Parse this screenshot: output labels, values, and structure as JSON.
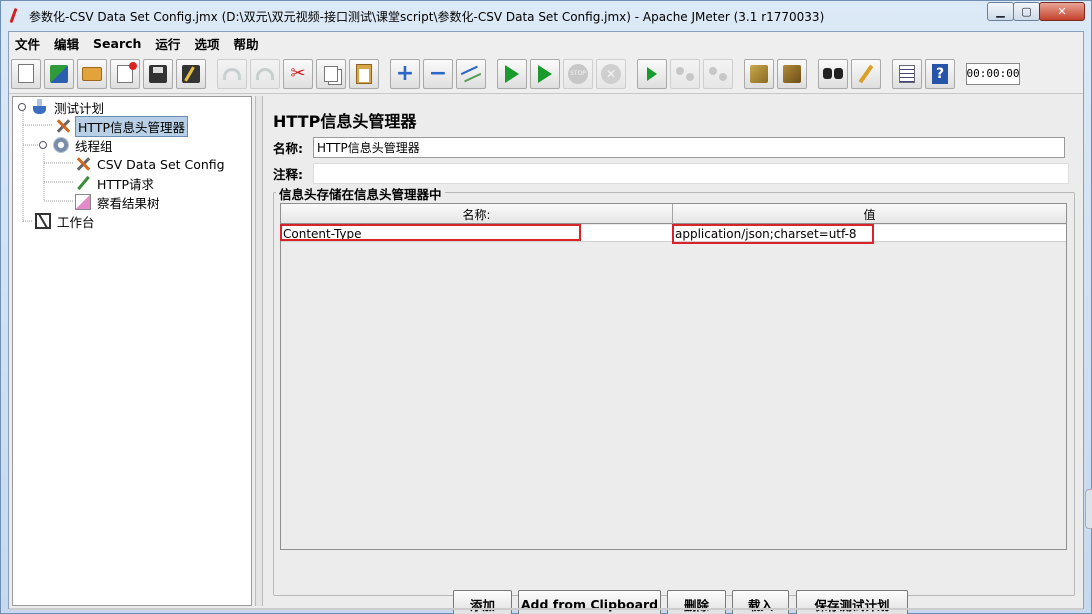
{
  "window": {
    "title": "参数化-CSV Data Set Config.jmx (D:\\双元\\双元视频-接口测试\\课堂script\\参数化-CSV Data Set Config.jmx) - Apache JMeter (3.1 r1770033)",
    "minimize_symbol": "▁",
    "maximize_symbol": "▢",
    "close_symbol": "✕"
  },
  "menu": {
    "items": [
      "文件",
      "编辑",
      "Search",
      "运行",
      "选项",
      "帮助"
    ]
  },
  "toolbar": {
    "timer": "00:00:00",
    "buttons": [
      {
        "name": "new-icon"
      },
      {
        "name": "templates-icon"
      },
      {
        "name": "open-icon"
      },
      {
        "name": "close-icon"
      },
      {
        "name": "save-icon"
      },
      {
        "name": "save-as-icon"
      },
      {
        "name": "undo-icon"
      },
      {
        "name": "redo-icon"
      },
      {
        "name": "cut-icon"
      },
      {
        "name": "copy-icon"
      },
      {
        "name": "paste-icon"
      },
      {
        "name": "expand-icon"
      },
      {
        "name": "collapse-icon"
      },
      {
        "name": "toggle-icon"
      },
      {
        "name": "start-icon"
      },
      {
        "name": "start-no-pause-icon"
      },
      {
        "name": "stop-icon"
      },
      {
        "name": "shutdown-icon"
      },
      {
        "name": "remote-start-icon"
      },
      {
        "name": "remote-stop-icon"
      },
      {
        "name": "remote-shutdown-icon"
      },
      {
        "name": "clear-icon"
      },
      {
        "name": "clear-all-icon"
      },
      {
        "name": "search-icon"
      },
      {
        "name": "reset-search-icon"
      },
      {
        "name": "function-helper-icon"
      },
      {
        "name": "help-icon"
      }
    ],
    "cut_glyph": "✂",
    "plus_glyph": "+",
    "minus_glyph": "−",
    "stop_glyph": "STOP",
    "shutdown_glyph": "✕",
    "help_glyph": "?"
  },
  "tree": {
    "nodes": [
      {
        "label": "测试计划"
      },
      {
        "label": "HTTP信息头管理器"
      },
      {
        "label": "线程组"
      },
      {
        "label": "CSV Data Set Config"
      },
      {
        "label": "HTTP请求"
      },
      {
        "label": "察看结果树"
      },
      {
        "label": "工作台"
      }
    ]
  },
  "panel": {
    "title": "HTTP信息头管理器",
    "name_label": "名称:",
    "name_value": "HTTP信息头管理器",
    "comment_label": "注释:",
    "comment_value": "",
    "group_title": "信息头存储在信息头管理器中",
    "table": {
      "columns": [
        "名称:",
        "值"
      ],
      "rows": [
        {
          "name": "Content-Type",
          "value": "application/json;charset=utf-8"
        }
      ]
    },
    "buttons": {
      "add": "添加",
      "add_clipboard": "Add from Clipboard",
      "delete": "删除",
      "load": "载入",
      "save_plan": "保存测试计划"
    }
  },
  "colors": {
    "highlight": "#d8232a",
    "selection": "#b8cfe5"
  }
}
